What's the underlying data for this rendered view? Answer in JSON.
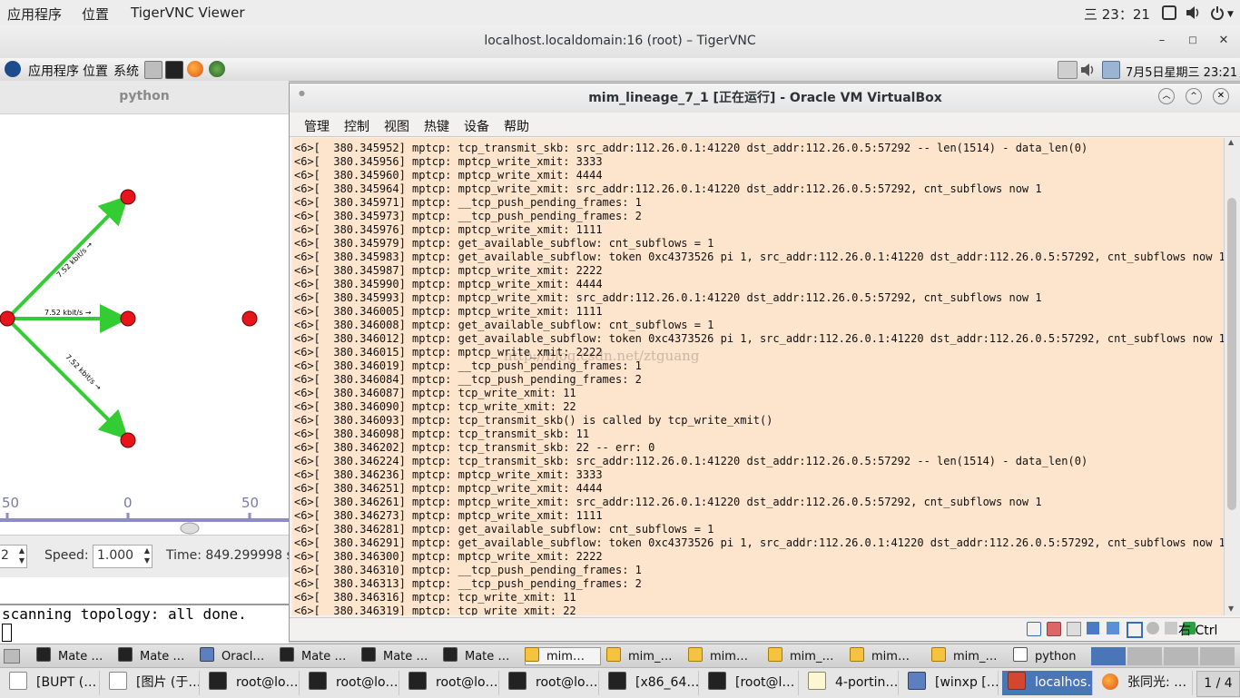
{
  "topbar": {
    "applications": "应用程序",
    "places": "位置",
    "app_name": "TigerVNC Viewer",
    "clock": "三 23：21"
  },
  "vnc": {
    "title": "localhost.localdomain:16 (root) – TigerVNC",
    "min": "–",
    "max": "□",
    "close": "✕"
  },
  "mate": {
    "applications": "应用程序",
    "places": "位置",
    "system": "系统",
    "datetime": "7月5日星期三 23:21"
  },
  "python_win": {
    "title": "python",
    "link_labels": [
      "7.52 kbit/s →",
      "7.52 kbit/s →",
      "7.52 kbit/s →"
    ],
    "axis_ticks": [
      "50",
      "0",
      "50"
    ],
    "step_value": "2",
    "speed_label": "Speed:",
    "speed_value": "1.000",
    "time_text": "Time: 849.299998 s",
    "terminal_line": "scanning topology: all done."
  },
  "vbox": {
    "title": "mim_lineage_7_1 [正在运行] - Oracle VM VirtualBox",
    "menu": [
      "管理",
      "控制",
      "视图",
      "热键",
      "设备",
      "帮助"
    ],
    "host_key": "右 Ctrl",
    "watermark": "http://blog.csdn.net/ztguang",
    "console_lines": [
      "<6>[  380.345952] mptcp: tcp_transmit_skb: src_addr:112.26.0.1:41220 dst_addr:112.26.0.5:57292 -- len(1514) - data_len(0)",
      "<6>[  380.345956] mptcp: mptcp_write_xmit: 3333",
      "<6>[  380.345960] mptcp: mptcp_write_xmit: 4444",
      "<6>[  380.345964] mptcp: mptcp_write_xmit: src_addr:112.26.0.1:41220 dst_addr:112.26.0.5:57292, cnt_subflows now 1",
      "<6>[  380.345971] mptcp: __tcp_push_pending_frames: 1",
      "<6>[  380.345973] mptcp: __tcp_push_pending_frames: 2",
      "<6>[  380.345976] mptcp: mptcp_write_xmit: 1111",
      "<6>[  380.345979] mptcp: get_available_subflow: cnt_subflows = 1",
      "<6>[  380.345983] mptcp: get_available_subflow: token 0xc4373526 pi 1, src_addr:112.26.0.1:41220 dst_addr:112.26.0.5:57292, cnt_subflows now 1",
      "<6>[  380.345987] mptcp: mptcp_write_xmit: 2222",
      "<6>[  380.345990] mptcp: mptcp_write_xmit: 4444",
      "<6>[  380.345993] mptcp: mptcp_write_xmit: src_addr:112.26.0.1:41220 dst_addr:112.26.0.5:57292, cnt_subflows now 1",
      "<6>[  380.346005] mptcp: mptcp_write_xmit: 1111",
      "<6>[  380.346008] mptcp: get_available_subflow: cnt_subflows = 1",
      "<6>[  380.346012] mptcp: get_available_subflow: token 0xc4373526 pi 1, src_addr:112.26.0.1:41220 dst_addr:112.26.0.5:57292, cnt_subflows now 1",
      "<6>[  380.346015] mptcp: mptcp_write_xmit: 2222",
      "<6>[  380.346019] mptcp: __tcp_push_pending_frames: 1",
      "<6>[  380.346084] mptcp: __tcp_push_pending_frames: 2",
      "<6>[  380.346087] mptcp: tcp_write_xmit: 11",
      "<6>[  380.346090] mptcp: tcp_write_xmit: 22",
      "<6>[  380.346093] mptcp: tcp_transmit_skb() is called by tcp_write_xmit()",
      "<6>[  380.346098] mptcp: tcp_transmit_skb: 11",
      "<6>[  380.346202] mptcp: tcp_transmit_skb: 22 -- err: 0",
      "<6>[  380.346224] mptcp: tcp_transmit_skb: src_addr:112.26.0.1:41220 dst_addr:112.26.0.5:57292 -- len(1514) - data_len(0)",
      "<6>[  380.346236] mptcp: mptcp_write_xmit: 3333",
      "<6>[  380.346251] mptcp: mptcp_write_xmit: 4444",
      "<6>[  380.346261] mptcp: mptcp_write_xmit: src_addr:112.26.0.1:41220 dst_addr:112.26.0.5:57292, cnt_subflows now 1",
      "<6>[  380.346273] mptcp: mptcp_write_xmit: 1111",
      "<6>[  380.346281] mptcp: get_available_subflow: cnt_subflows = 1",
      "<6>[  380.346291] mptcp: get_available_subflow: token 0xc4373526 pi 1, src_addr:112.26.0.1:41220 dst_addr:112.26.0.5:57292, cnt_subflows now 1",
      "<6>[  380.346300] mptcp: mptcp_write_xmit: 2222",
      "<6>[  380.346310] mptcp: __tcp_push_pending_frames: 1",
      "<6>[  380.346313] mptcp: __tcp_push_pending_frames: 2",
      "<6>[  380.346316] mptcp: tcp_write_xmit: 11",
      "<6>[  380.346319] mptcp: tcp_write_xmit: 22"
    ]
  },
  "taskbar_inner": [
    {
      "label": "Mate …",
      "icon": "terminal-icon"
    },
    {
      "label": "Mate …",
      "icon": "terminal-icon"
    },
    {
      "label": "Oracl…",
      "icon": "virtualbox-icon"
    },
    {
      "label": "Mate …",
      "icon": "terminal-icon"
    },
    {
      "label": "Mate …",
      "icon": "terminal-icon"
    },
    {
      "label": "Mate …",
      "icon": "terminal-icon"
    },
    {
      "label": "mim…",
      "icon": "virtualbox-vm-icon"
    },
    {
      "label": "mim_…",
      "icon": "virtualbox-vm-icon"
    },
    {
      "label": "mim…",
      "icon": "virtualbox-vm-icon"
    },
    {
      "label": "mim_…",
      "icon": "virtualbox-vm-icon"
    },
    {
      "label": "mim…",
      "icon": "virtualbox-vm-icon"
    },
    {
      "label": "mim_…",
      "icon": "virtualbox-vm-icon"
    },
    {
      "label": "python",
      "icon": "window-icon"
    }
  ],
  "taskbar_host": [
    {
      "label": "[BUPT (…",
      "icon": "document-icon"
    },
    {
      "label": "[图片 (于…",
      "icon": "document-icon"
    },
    {
      "label": "root@lo…",
      "icon": "terminal-icon"
    },
    {
      "label": "root@lo…",
      "icon": "terminal-icon"
    },
    {
      "label": "root@lo…",
      "icon": "terminal-icon"
    },
    {
      "label": "root@lo…",
      "icon": "terminal-icon"
    },
    {
      "label": "[x86_64…",
      "icon": "terminal-icon"
    },
    {
      "label": "[root@l…",
      "icon": "terminal-icon"
    },
    {
      "label": "4-portin…",
      "icon": "text-editor-icon"
    },
    {
      "label": "[winxp [….",
      "icon": "virtualbox-icon"
    },
    {
      "label": "localhos…",
      "icon": "vnc-icon"
    },
    {
      "label": "张同光: …",
      "icon": "firefox-icon"
    }
  ],
  "workspace": "1 / 4",
  "colors": {
    "console_bg": "#fde4cc",
    "node": "#e8141c",
    "link": "#33cc33",
    "active_task": "#4a76b8"
  }
}
